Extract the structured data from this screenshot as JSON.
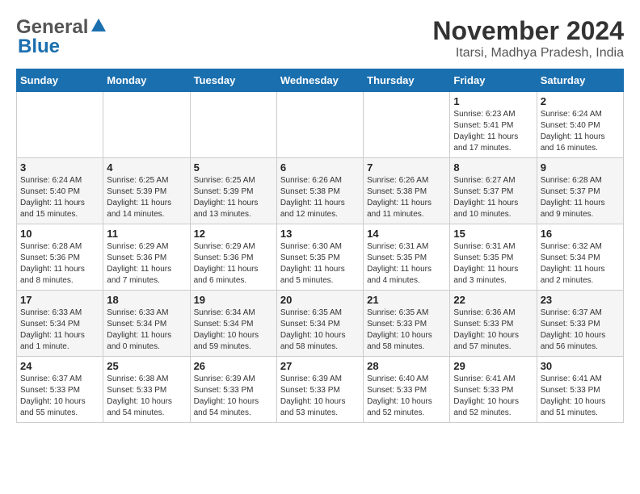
{
  "header": {
    "logo_general": "General",
    "logo_blue": "Blue",
    "month_title": "November 2024",
    "location": "Itarsi, Madhya Pradesh, India"
  },
  "weekdays": [
    "Sunday",
    "Monday",
    "Tuesday",
    "Wednesday",
    "Thursday",
    "Friday",
    "Saturday"
  ],
  "weeks": [
    [
      {
        "day": "",
        "details": ""
      },
      {
        "day": "",
        "details": ""
      },
      {
        "day": "",
        "details": ""
      },
      {
        "day": "",
        "details": ""
      },
      {
        "day": "",
        "details": ""
      },
      {
        "day": "1",
        "details": "Sunrise: 6:23 AM\nSunset: 5:41 PM\nDaylight: 11 hours\nand 17 minutes."
      },
      {
        "day": "2",
        "details": "Sunrise: 6:24 AM\nSunset: 5:40 PM\nDaylight: 11 hours\nand 16 minutes."
      }
    ],
    [
      {
        "day": "3",
        "details": "Sunrise: 6:24 AM\nSunset: 5:40 PM\nDaylight: 11 hours\nand 15 minutes."
      },
      {
        "day": "4",
        "details": "Sunrise: 6:25 AM\nSunset: 5:39 PM\nDaylight: 11 hours\nand 14 minutes."
      },
      {
        "day": "5",
        "details": "Sunrise: 6:25 AM\nSunset: 5:39 PM\nDaylight: 11 hours\nand 13 minutes."
      },
      {
        "day": "6",
        "details": "Sunrise: 6:26 AM\nSunset: 5:38 PM\nDaylight: 11 hours\nand 12 minutes."
      },
      {
        "day": "7",
        "details": "Sunrise: 6:26 AM\nSunset: 5:38 PM\nDaylight: 11 hours\nand 11 minutes."
      },
      {
        "day": "8",
        "details": "Sunrise: 6:27 AM\nSunset: 5:37 PM\nDaylight: 11 hours\nand 10 minutes."
      },
      {
        "day": "9",
        "details": "Sunrise: 6:28 AM\nSunset: 5:37 PM\nDaylight: 11 hours\nand 9 minutes."
      }
    ],
    [
      {
        "day": "10",
        "details": "Sunrise: 6:28 AM\nSunset: 5:36 PM\nDaylight: 11 hours\nand 8 minutes."
      },
      {
        "day": "11",
        "details": "Sunrise: 6:29 AM\nSunset: 5:36 PM\nDaylight: 11 hours\nand 7 minutes."
      },
      {
        "day": "12",
        "details": "Sunrise: 6:29 AM\nSunset: 5:36 PM\nDaylight: 11 hours\nand 6 minutes."
      },
      {
        "day": "13",
        "details": "Sunrise: 6:30 AM\nSunset: 5:35 PM\nDaylight: 11 hours\nand 5 minutes."
      },
      {
        "day": "14",
        "details": "Sunrise: 6:31 AM\nSunset: 5:35 PM\nDaylight: 11 hours\nand 4 minutes."
      },
      {
        "day": "15",
        "details": "Sunrise: 6:31 AM\nSunset: 5:35 PM\nDaylight: 11 hours\nand 3 minutes."
      },
      {
        "day": "16",
        "details": "Sunrise: 6:32 AM\nSunset: 5:34 PM\nDaylight: 11 hours\nand 2 minutes."
      }
    ],
    [
      {
        "day": "17",
        "details": "Sunrise: 6:33 AM\nSunset: 5:34 PM\nDaylight: 11 hours\nand 1 minute."
      },
      {
        "day": "18",
        "details": "Sunrise: 6:33 AM\nSunset: 5:34 PM\nDaylight: 11 hours\nand 0 minutes."
      },
      {
        "day": "19",
        "details": "Sunrise: 6:34 AM\nSunset: 5:34 PM\nDaylight: 10 hours\nand 59 minutes."
      },
      {
        "day": "20",
        "details": "Sunrise: 6:35 AM\nSunset: 5:34 PM\nDaylight: 10 hours\nand 58 minutes."
      },
      {
        "day": "21",
        "details": "Sunrise: 6:35 AM\nSunset: 5:33 PM\nDaylight: 10 hours\nand 58 minutes."
      },
      {
        "day": "22",
        "details": "Sunrise: 6:36 AM\nSunset: 5:33 PM\nDaylight: 10 hours\nand 57 minutes."
      },
      {
        "day": "23",
        "details": "Sunrise: 6:37 AM\nSunset: 5:33 PM\nDaylight: 10 hours\nand 56 minutes."
      }
    ],
    [
      {
        "day": "24",
        "details": "Sunrise: 6:37 AM\nSunset: 5:33 PM\nDaylight: 10 hours\nand 55 minutes."
      },
      {
        "day": "25",
        "details": "Sunrise: 6:38 AM\nSunset: 5:33 PM\nDaylight: 10 hours\nand 54 minutes."
      },
      {
        "day": "26",
        "details": "Sunrise: 6:39 AM\nSunset: 5:33 PM\nDaylight: 10 hours\nand 54 minutes."
      },
      {
        "day": "27",
        "details": "Sunrise: 6:39 AM\nSunset: 5:33 PM\nDaylight: 10 hours\nand 53 minutes."
      },
      {
        "day": "28",
        "details": "Sunrise: 6:40 AM\nSunset: 5:33 PM\nDaylight: 10 hours\nand 52 minutes."
      },
      {
        "day": "29",
        "details": "Sunrise: 6:41 AM\nSunset: 5:33 PM\nDaylight: 10 hours\nand 52 minutes."
      },
      {
        "day": "30",
        "details": "Sunrise: 6:41 AM\nSunset: 5:33 PM\nDaylight: 10 hours\nand 51 minutes."
      }
    ]
  ]
}
